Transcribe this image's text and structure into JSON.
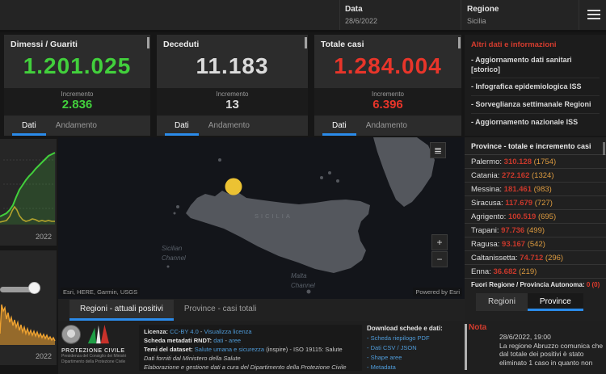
{
  "topbar": {
    "data_label": "Data",
    "data_value": "28/6/2022",
    "region_label": "Regione",
    "region_value": "Sicilia"
  },
  "cards": [
    {
      "title": "Dimessi / Guariti",
      "value": "1.201.025",
      "increment_label": "Incremento",
      "increment_value": "2.836",
      "tab_dati": "Dati",
      "tab_andamento": "Andamento"
    },
    {
      "title": "Deceduti",
      "value": "11.183",
      "increment_label": "Incremento",
      "increment_value": "13",
      "tab_dati": "Dati",
      "tab_andamento": "Andamento"
    },
    {
      "title": "Totale casi",
      "value": "1.284.004",
      "increment_label": "Incremento",
      "increment_value": "6.396",
      "tab_dati": "Dati",
      "tab_andamento": "Andamento"
    }
  ],
  "info_panel": {
    "title": "Altri dati e informazioni",
    "links": [
      "- Aggiornamento dati sanitari [storico]",
      "- Infografica epidemiologica ISS",
      "- Sorveglianza settimanale Regioni",
      "- Aggiornamento nazionale ISS"
    ]
  },
  "province_panel": {
    "title": "Province - totale e incremento casi",
    "rows": [
      {
        "name": "Palermo:",
        "total": "310.128",
        "inc": "(1754)"
      },
      {
        "name": "Catania:",
        "total": "272.162",
        "inc": "(1324)"
      },
      {
        "name": "Messina:",
        "total": "181.461",
        "inc": "(983)"
      },
      {
        "name": "Siracusa:",
        "total": "117.679",
        "inc": "(727)"
      },
      {
        "name": "Agrigento:",
        "total": "100.519",
        "inc": "(695)"
      },
      {
        "name": "Trapani:",
        "total": "97.736",
        "inc": "(499)"
      },
      {
        "name": "Ragusa:",
        "total": "93.167",
        "inc": "(542)"
      },
      {
        "name": "Caltanissetta:",
        "total": "74.712",
        "inc": "(296)"
      },
      {
        "name": "Enna:",
        "total": "36.682",
        "inc": "(219)"
      }
    ],
    "fuori_label": "Fuori Regione / Provincia Autonoma: ",
    "fuori_value": "0 (0)",
    "tab_regioni": "Regioni",
    "tab_province": "Province"
  },
  "map": {
    "label_island": "SICILIA",
    "label_ch1_a": "Sicilian",
    "label_ch1_b": "Channel",
    "label_ch2_a": "Malta",
    "label_ch2_b": "Channel",
    "attribution": "Esri, HERE, Garmin, USGS",
    "powered": "Powered by Esri",
    "zoom_in": "+",
    "zoom_out": "−",
    "legend_glyph": "≣",
    "tab_regioni": "Regioni - attuali positivi",
    "tab_province": "Province - casi totali"
  },
  "charts": {
    "top": {
      "green_line": "0,90 4,88 8,86 12,82 16,76 20,66 24,57 28,51 32,45 36,40 40,36 44,31 48,27 52,23 56,19 60,15 64,13 68,11",
      "green_fill": "0,90 4,88 8,86 12,82 16,76 20,66 24,57 28,51 32,45 36,40 40,36 44,31 48,27 52,23 56,19 60,15 64,13 68,11 68,100 0,100",
      "yellow_line": "0,97 4,96 8,95 12,90 15,83 18,78 21,82 24,89 28,94 32,96 36,95 40,93 44,94 48,96 52,95 56,96 60,95 64,96 68,96",
      "x_label": "2022"
    },
    "bottom": {
      "orange_line": "0,44 2,8 4,16 6,12 8,26 10,18 12,30 14,24 16,34 18,27 20,36 22,30 24,40 26,33 28,42 30,36 32,44 34,38 36,45 38,40 40,46 42,41 44,47 46,42 48,48 50,44 52,49 54,45 56,50 58,46 60,51 62,48 64,52 66,49 68,53",
      "orange_fill": "0,44 2,8 4,16 6,12 8,26 10,18 12,30 14,24 16,34 18,27 20,36 22,30 24,40 26,33 28,42 30,36 32,44 34,38 36,45 38,40 40,46 42,41 44,47 46,42 48,48 50,44 52,49 54,45 56,50 58,46 60,51 62,48 64,52 66,49 68,53 68,58 0,58",
      "x_label": "2022"
    }
  },
  "footer": {
    "logo_title": "PROTEZIONE CIVILE",
    "logo_sub1": "Presidenza del Consiglio dei Ministri",
    "logo_sub2": "Dipartimento della Protezione Civile",
    "lic1_label": "Licenza: ",
    "lic1_link1": "CC-BY 4.0",
    "lic1_sep": " - ",
    "lic1_link2": "Visualizza licenza",
    "lic2_label": "Scheda metadati RNDT: ",
    "lic2_link1": "dati",
    "lic2_sep": " - ",
    "lic2_link2": "aree",
    "lic3_label": "Temi del dataset: ",
    "lic3_link1": "Salute umana e sicurezza",
    "lic3_rest": " (inspire) - ISO 19115: Salute",
    "lic4": "Dati forniti dal Ministero della Salute",
    "lic5": "Elaborazione e gestione dati a cura del Dipartimento della Protezione Civile",
    "download_title": "Download schede e dati:",
    "download_links": [
      "- Scheda riepilogo PDF",
      "- Dati CSV / JSON",
      "- Shape aree",
      "- Metadata"
    ],
    "nota_title": "Nota",
    "nota_date": "28/6/2022, 19:00",
    "nota_text": "La regione Abruzzo comunica che dal totale dei positivi è stato eliminato 1 caso in quanto non"
  }
}
